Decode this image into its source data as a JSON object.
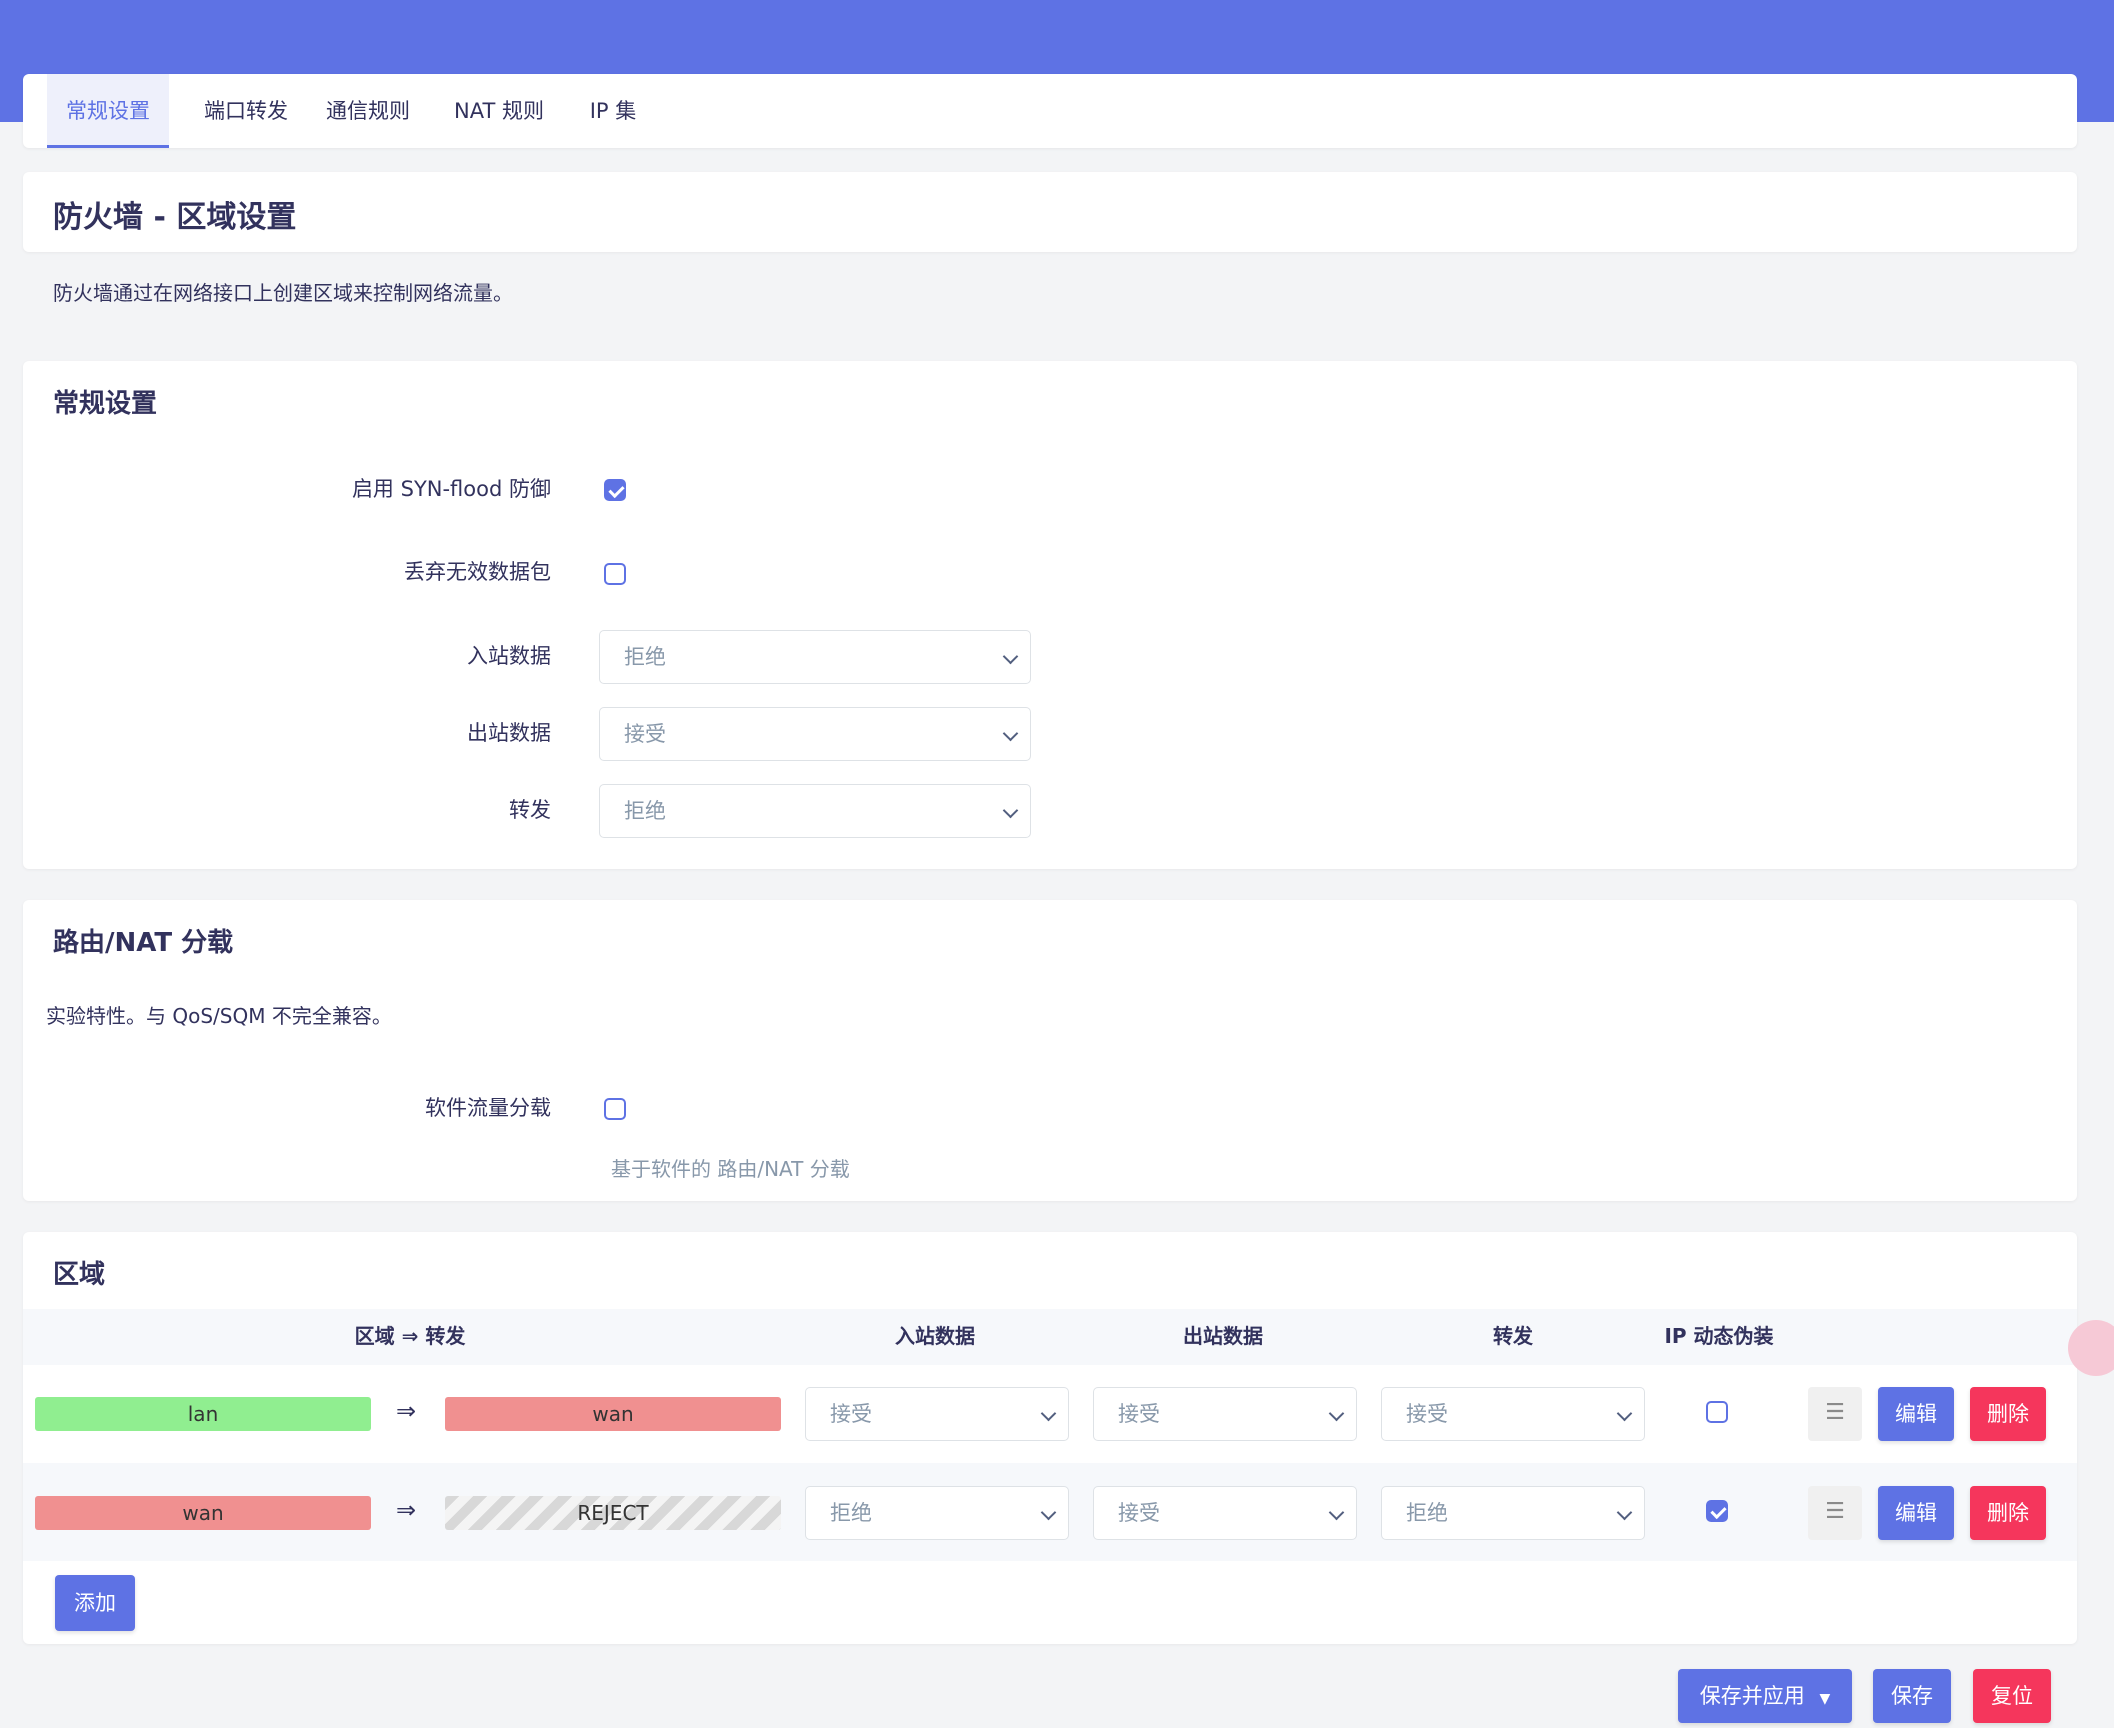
{
  "tabs": [
    "常规设置",
    "端口转发",
    "通信规则",
    "NAT 规则",
    "IP 集"
  ],
  "page": {
    "title": "防火墙 - 区域设置",
    "description": "防火墙通过在网络接口上创建区域来控制网络流量。"
  },
  "general": {
    "title": "常规设置",
    "syn_flood_label": "启用 SYN-flood 防御",
    "syn_flood_checked": true,
    "drop_invalid_label": "丢弃无效数据包",
    "drop_invalid_checked": false,
    "input_label": "入站数据",
    "input_value": "拒绝",
    "output_label": "出站数据",
    "output_value": "接受",
    "forward_label": "转发",
    "forward_value": "拒绝"
  },
  "offload": {
    "title": "路由/NAT 分载",
    "description": "实验特性。与 QoS/SQM 不完全兼容。",
    "software_label": "软件流量分载",
    "software_checked": false,
    "software_hint": "基于软件的 路由/NAT 分载"
  },
  "zones": {
    "title": "区域",
    "headers": {
      "zone_forward": "区域 ⇒ 转发",
      "input": "入站数据",
      "output": "出站数据",
      "forward": "转发",
      "masq": "IP 动态伪装"
    },
    "rows": [
      {
        "zone": "lan",
        "arrow": "⇒",
        "target": "wan",
        "input": "接受",
        "output": "接受",
        "forward": "接受",
        "masq": false,
        "edit": "编辑",
        "delete": "删除"
      },
      {
        "zone": "wan",
        "arrow": "⇒",
        "target": "REJECT",
        "input": "拒绝",
        "output": "接受",
        "forward": "拒绝",
        "masq": true,
        "edit": "编辑",
        "delete": "删除"
      }
    ],
    "add_label": "添加",
    "handle_glyph": "☰"
  },
  "footer": {
    "save_apply": "保存并应用",
    "save": "保存",
    "reset": "复位"
  },
  "colors": {
    "primary": "#5e72e4",
    "danger": "#f5365c",
    "zone_lan": "#90ee90",
    "zone_wan": "#f09090"
  }
}
